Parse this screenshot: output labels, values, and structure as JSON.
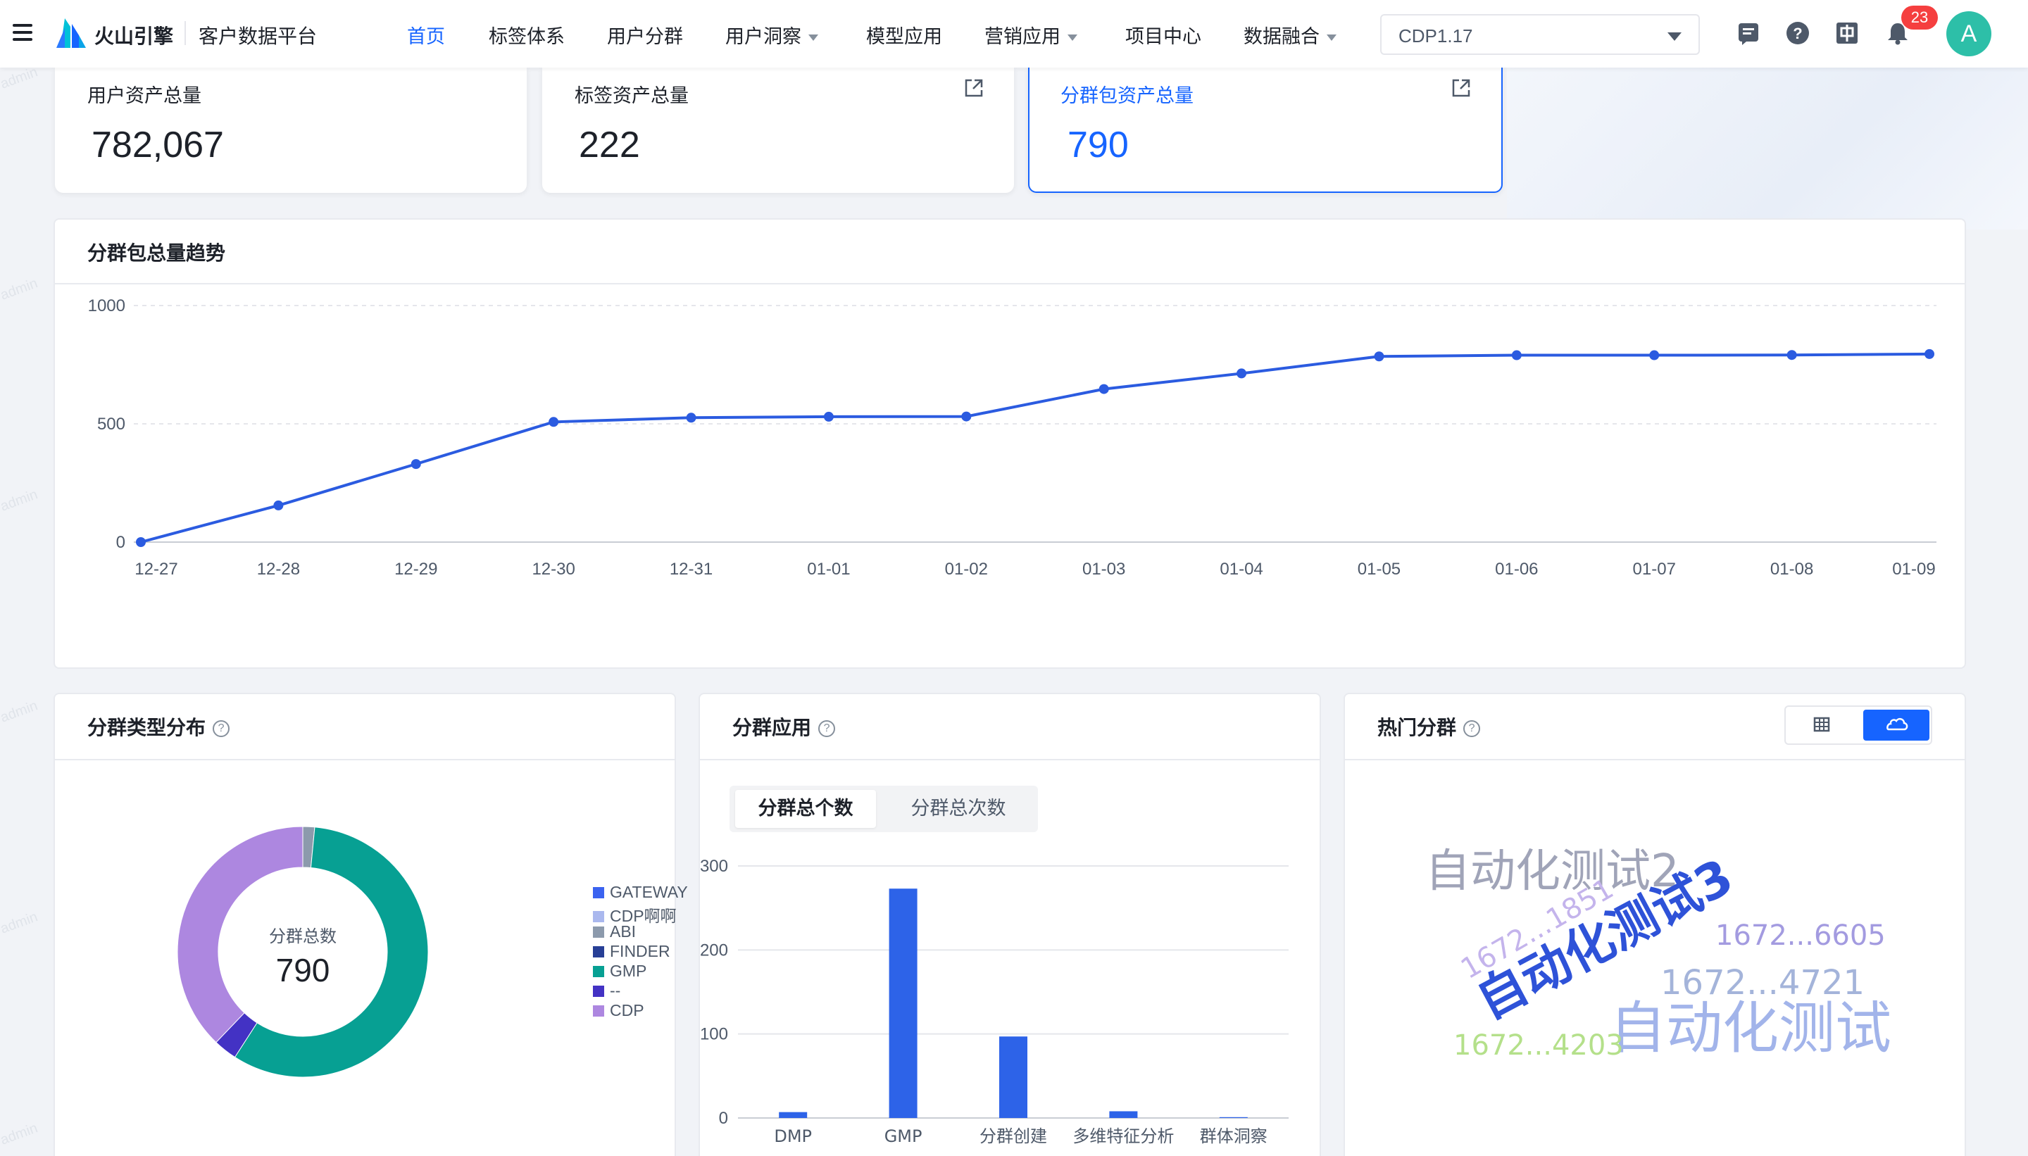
{
  "header": {
    "brand": "火山引擎",
    "product": "客户数据平台",
    "nav": [
      {
        "label": "首页",
        "active": true,
        "dropdown": false
      },
      {
        "label": "标签体系",
        "active": false,
        "dropdown": false
      },
      {
        "label": "用户分群",
        "active": false,
        "dropdown": false
      },
      {
        "label": "用户洞察",
        "active": false,
        "dropdown": true
      },
      {
        "label": "模型应用",
        "active": false,
        "dropdown": false
      },
      {
        "label": "营销应用",
        "active": false,
        "dropdown": true
      },
      {
        "label": "项目中心",
        "active": false,
        "dropdown": false
      },
      {
        "label": "数据融合",
        "active": false,
        "dropdown": true
      }
    ],
    "project_select": "CDP1.17",
    "icons": [
      "menu-icon",
      "message-icon",
      "help-icon",
      "language-icon",
      "bell-icon"
    ],
    "notification_count": "23",
    "avatar_letter": "A"
  },
  "watermark": "admin",
  "stats": [
    {
      "label": "用户资产总量",
      "value": "782,067",
      "external": false,
      "selected": false
    },
    {
      "label": "标签资产总量",
      "value": "222",
      "external": true,
      "selected": false
    },
    {
      "label": "分群包资产总量",
      "value": "790",
      "external": true,
      "selected": true
    }
  ],
  "trend": {
    "title": "分群包总量趋势"
  },
  "type_dist": {
    "title": "分群类型分布",
    "center_label": "分群总数",
    "center_value": "790"
  },
  "app": {
    "title": "分群应用",
    "tabs": [
      "分群总个数",
      "分群总次数"
    ],
    "active_tab": 0
  },
  "hot": {
    "title": "热门分群",
    "view_toggle": [
      "table-icon",
      "cloud-icon"
    ],
    "active_view": 1,
    "words": [
      {
        "text": "自动化测试2",
        "color": "#a0a4b8"
      },
      {
        "text": "自动化测试3",
        "color": "#2e52d8"
      },
      {
        "text": "1672...1851",
        "color": "#c4b4ec"
      },
      {
        "text": "1672...6605",
        "color": "#a39be0"
      },
      {
        "text": "1672...4721",
        "color": "#a4b4da"
      },
      {
        "text": "自动化测试",
        "color": "#a2b4ea"
      },
      {
        "text": "1672...4203",
        "color": "#b4e08a"
      }
    ]
  },
  "colors": {
    "accent": "#1664ff",
    "line": "#2b5be0",
    "bar": "#2d63e8"
  },
  "chart_data": [
    {
      "type": "line",
      "title": "分群包总量趋势",
      "x": [
        "12-27",
        "12-28",
        "12-29",
        "12-30",
        "12-31",
        "01-01",
        "01-02",
        "01-03",
        "01-04",
        "01-05",
        "01-06",
        "01-07",
        "01-08",
        "01-09"
      ],
      "y": [
        0,
        155,
        330,
        508,
        526,
        530,
        531,
        647,
        713,
        785,
        790,
        790,
        791,
        795
      ],
      "yticks": [
        0,
        500,
        1000
      ],
      "ylim": [
        0,
        1000
      ],
      "grid": true
    },
    {
      "type": "pie",
      "title": "分群类型分布",
      "donut": true,
      "labels": [
        "GATEWAY",
        "CDP啊啊",
        "ABI",
        "FINDER",
        "GMP",
        "--",
        "CDP"
      ],
      "colors": [
        "#3b63f0",
        "#aab8ee",
        "#8c9aac",
        "#273f96",
        "#07a093",
        "#4332c4",
        "#ad87e0"
      ],
      "values": [
        0,
        0,
        12,
        0,
        455,
        24,
        299
      ]
    },
    {
      "type": "bar",
      "title": "分群应用",
      "categories": [
        "DMP",
        "GMP",
        "分群创建",
        "多维特征分析",
        "群体洞察"
      ],
      "values": [
        7,
        273,
        97,
        8,
        1
      ],
      "yticks": [
        0,
        100,
        200,
        300
      ],
      "ylim": [
        0,
        300
      ],
      "grid": true
    }
  ]
}
